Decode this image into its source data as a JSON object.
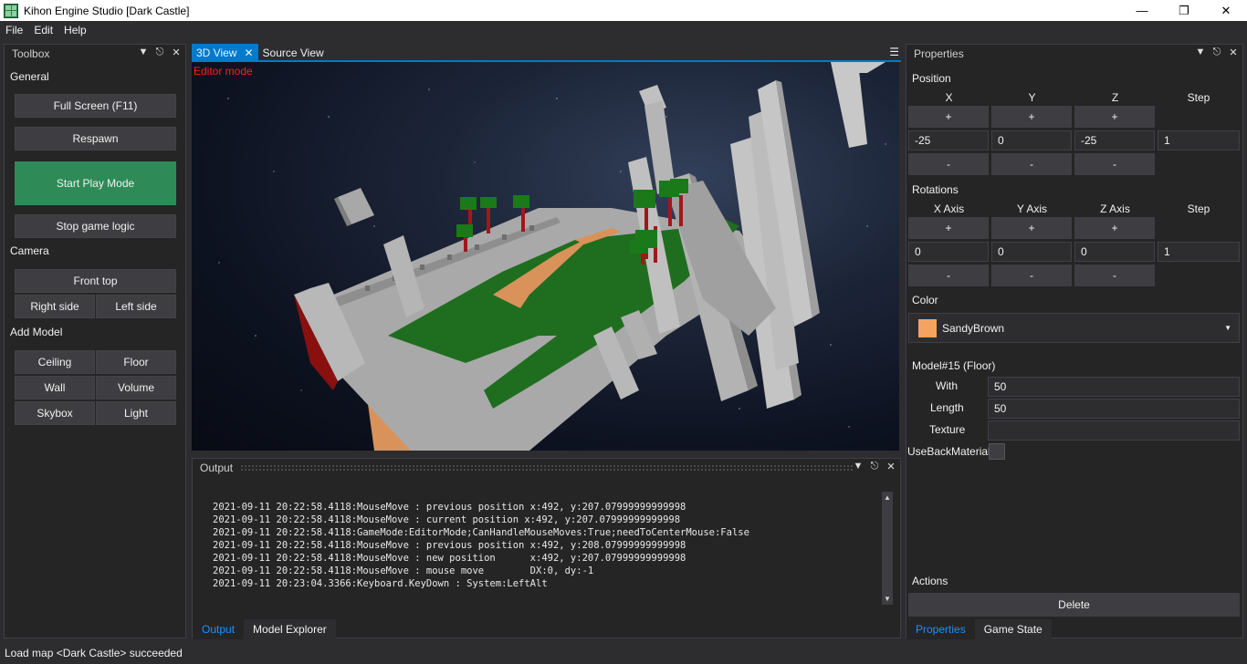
{
  "window": {
    "title": "Kihon Engine Studio [Dark Castle]",
    "minimize_icon": "minimize-icon",
    "maximize_icon": "restore-icon",
    "close_icon": "close-icon"
  },
  "menu": [
    "File",
    "Edit",
    "Help"
  ],
  "toolbox": {
    "title": "Toolbox",
    "general_label": "General",
    "full_screen": "Full Screen (F11)",
    "respawn": "Respawn",
    "start_play": "Start Play Mode",
    "stop_logic": "Stop game logic",
    "camera_label": "Camera",
    "front_top": "Front top",
    "right_side": "Right side",
    "left_side": "Left side",
    "add_model_label": "Add Model",
    "ceiling": "Ceiling",
    "floor": "Floor",
    "wall": "Wall",
    "volume": "Volume",
    "skybox": "Skybox",
    "light": "Light",
    "start_play_color": "#2e8b57"
  },
  "doc_tabs": {
    "tab_3d": "3D View",
    "tab_source": "Source View",
    "editor_mode": "Editor mode"
  },
  "output": {
    "title": "Output",
    "lines": [
      "2021-09-11 20:22:58.4118:MouseMove : previous position x:492, y:207.07999999999998",
      "2021-09-11 20:22:58.4118:MouseMove : current position x:492, y:207.07999999999998",
      "2021-09-11 20:22:58.4118:GameMode:EditorMode;CanHandleMouseMoves:True;needToCenterMouse:False",
      "2021-09-11 20:22:58.4118:MouseMove : previous position x:492, y:208.07999999999998",
      "2021-09-11 20:22:58.4118:MouseMove : new position      x:492, y:207.07999999999998",
      "2021-09-11 20:22:58.4118:MouseMove : mouse move        DX:0, dy:-1",
      "2021-09-11 20:23:04.3366:Keyboard.KeyDown : System:LeftAlt"
    ],
    "tab_output": "Output",
    "tab_model_explorer": "Model Explorer"
  },
  "properties": {
    "title": "Properties",
    "position_label": "Position",
    "col_x": "X",
    "col_y": "Y",
    "col_z": "Z",
    "col_step": "Step",
    "plus": "+",
    "minus": "-",
    "pos_x": "-25",
    "pos_y": "0",
    "pos_z": "-25",
    "pos_step": "1",
    "rotations_label": "Rotations",
    "col_xaxis": "X Axis",
    "col_yaxis": "Y Axis",
    "col_zaxis": "Z Axis",
    "rot_x": "0",
    "rot_y": "0",
    "rot_z": "0",
    "rot_step": "1",
    "color_label": "Color",
    "color_name": "SandyBrown",
    "color_hex": "#f4a460",
    "model_label": "Model#15 (Floor)",
    "with_label": "With",
    "with_value": "50",
    "length_label": "Length",
    "length_value": "50",
    "texture_label": "Texture",
    "texture_value": "",
    "usebackmaterial_label": "UseBackMaterial",
    "usebackmaterial_checked": false,
    "actions_label": "Actions",
    "delete_label": "Delete",
    "tab_properties": "Properties",
    "tab_game_state": "Game State"
  },
  "status": "Load map <Dark Castle> succeeded"
}
